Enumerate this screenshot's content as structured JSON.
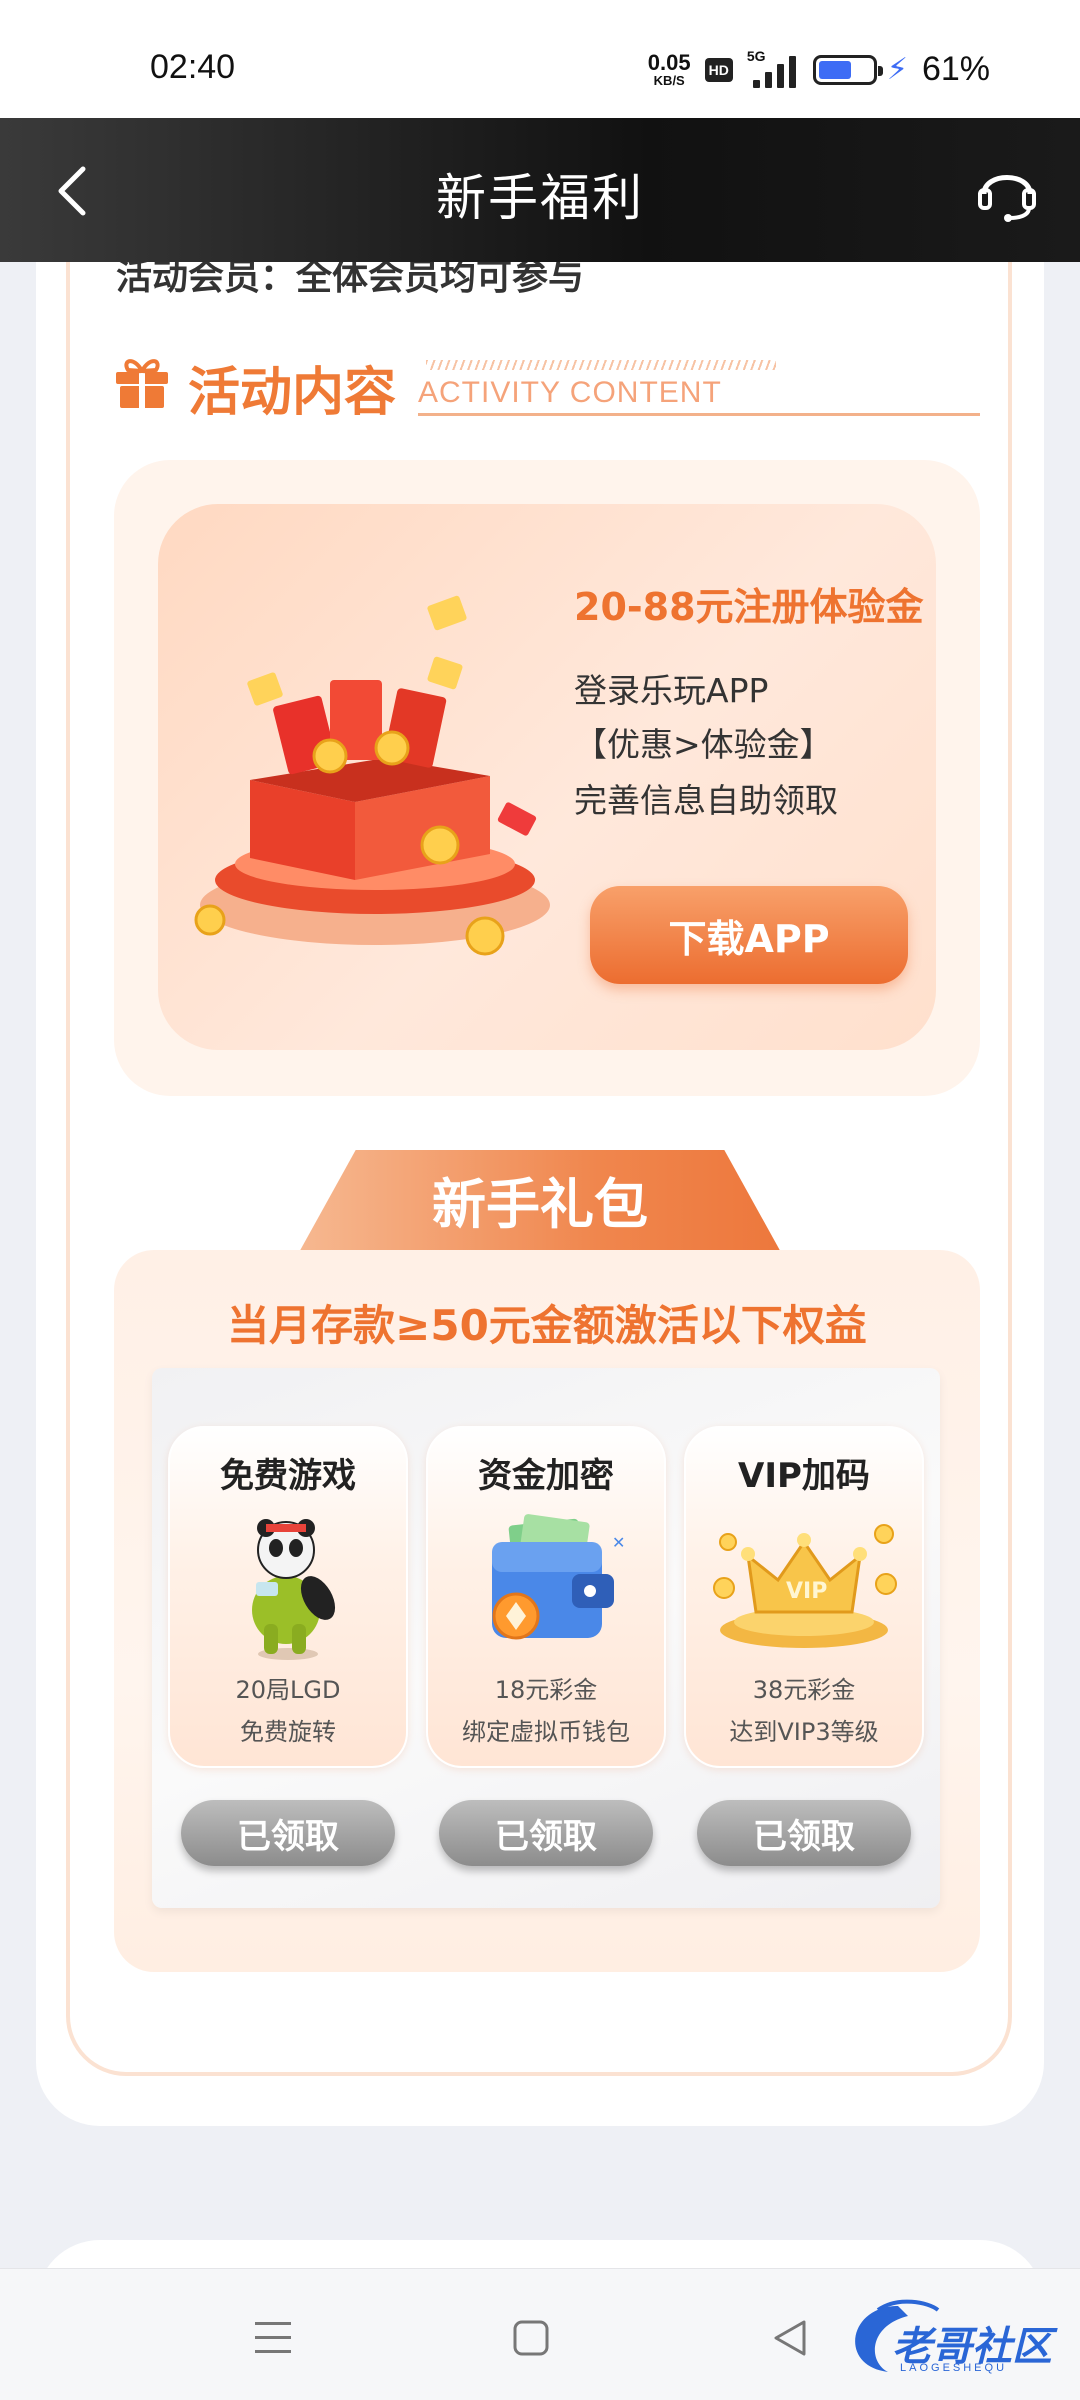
{
  "status_bar": {
    "time": "02:40",
    "net_speed_value": "0.05",
    "net_speed_unit": "KB/S",
    "hd_badge": "HD",
    "network_type": "5G",
    "battery_percent": "61%",
    "battery_level": 0.61,
    "charging": true
  },
  "nav": {
    "title": "新手福利",
    "back_icon": "chevron-left-icon",
    "service_icon": "headset-icon"
  },
  "activity": {
    "member_line": "活动会员：全体会员均可参与",
    "section_title": "活动内容",
    "section_subtitle": "ACTIVITY CONTENT",
    "bonus_title": "20-88元注册体验金",
    "steps": [
      "登录乐玩APP",
      "【优惠>体验金】",
      "完善信息自助领取"
    ],
    "download_label": "下载APP"
  },
  "pack": {
    "tab_label": "新手礼包",
    "headline": "当月存款≥50元金额激活以下权益",
    "benefits": [
      {
        "title": "免费游戏",
        "line1": "20局LGD",
        "line2": "免费旋转",
        "button": "已领取",
        "icon": "panda-character-icon"
      },
      {
        "title": "资金加密",
        "line1": "18元彩金",
        "line2": "绑定虚拟币钱包",
        "button": "已领取",
        "icon": "wallet-icon"
      },
      {
        "title": "VIP加码",
        "line1": "38元彩金",
        "line2": "达到VIP3等级",
        "button": "已领取",
        "icon": "crown-icon"
      }
    ]
  },
  "system_nav": {
    "menu_icon": "menu-icon",
    "home_icon": "square-home-icon",
    "back_icon": "triangle-back-icon"
  },
  "watermark": {
    "text": "老哥社区",
    "subtext": "LAOGESHEQU"
  },
  "colors": {
    "accent": "#ee7330",
    "nav_bg": "#1a1a1a",
    "claimed_button": "#9a9a9a",
    "battery": "#3d6cf5"
  }
}
